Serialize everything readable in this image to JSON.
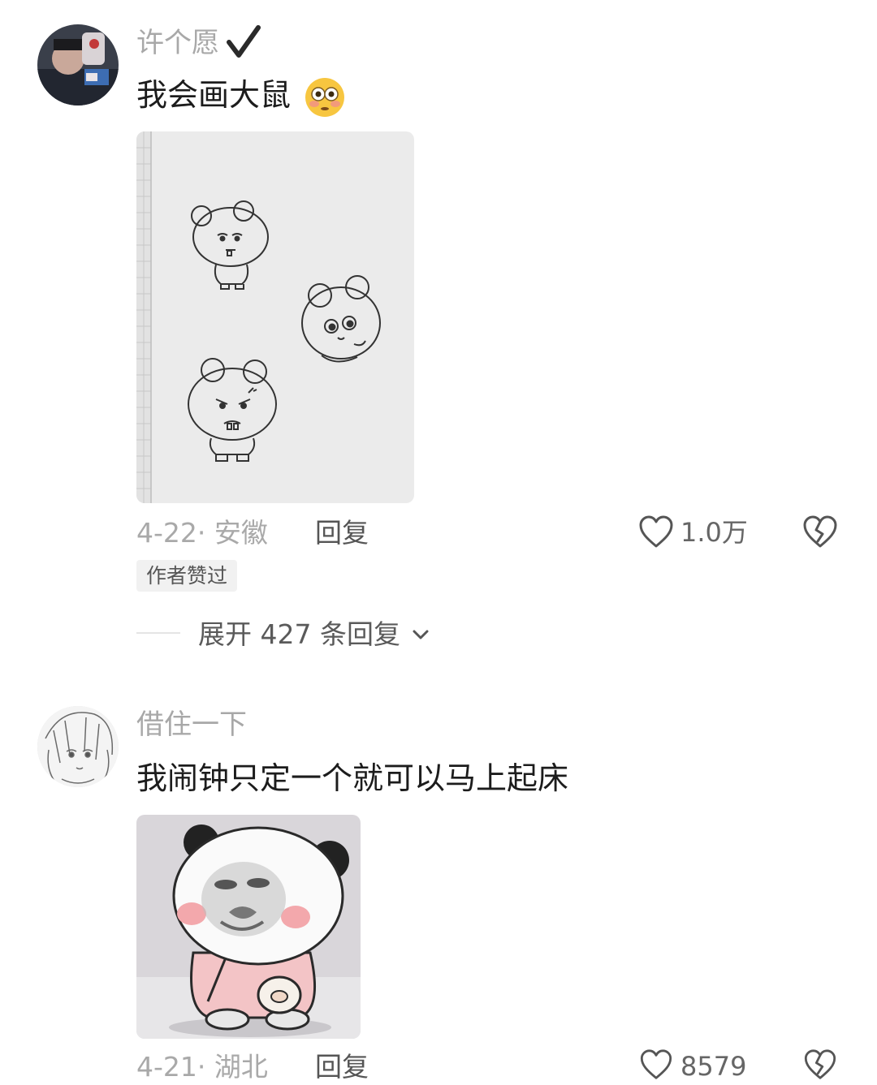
{
  "comments": [
    {
      "username": "许个愿",
      "verified_icon": "checkmark-icon",
      "text": "我会画大鼠",
      "emoji": "flushed-face-emoji",
      "image": "hand-drawn-mice-sketch",
      "date_location": "4-22· 安徽",
      "reply_label": "回复",
      "like_count": "1.0万",
      "author_badge": "作者赞过",
      "expand_label": "展开 427 条回复"
    },
    {
      "username": "借住一下",
      "text": "我闹钟只定一个就可以马上起床",
      "image": "panda-meme-sticker",
      "date_location": "4-21· 湖北",
      "reply_label": "回复",
      "like_count": "8579"
    }
  ],
  "colors": {
    "username": "#a8a8a8",
    "meta": "#a9a9a9",
    "text": "#1c1c1c",
    "badge_bg": "#f1f1f1"
  }
}
